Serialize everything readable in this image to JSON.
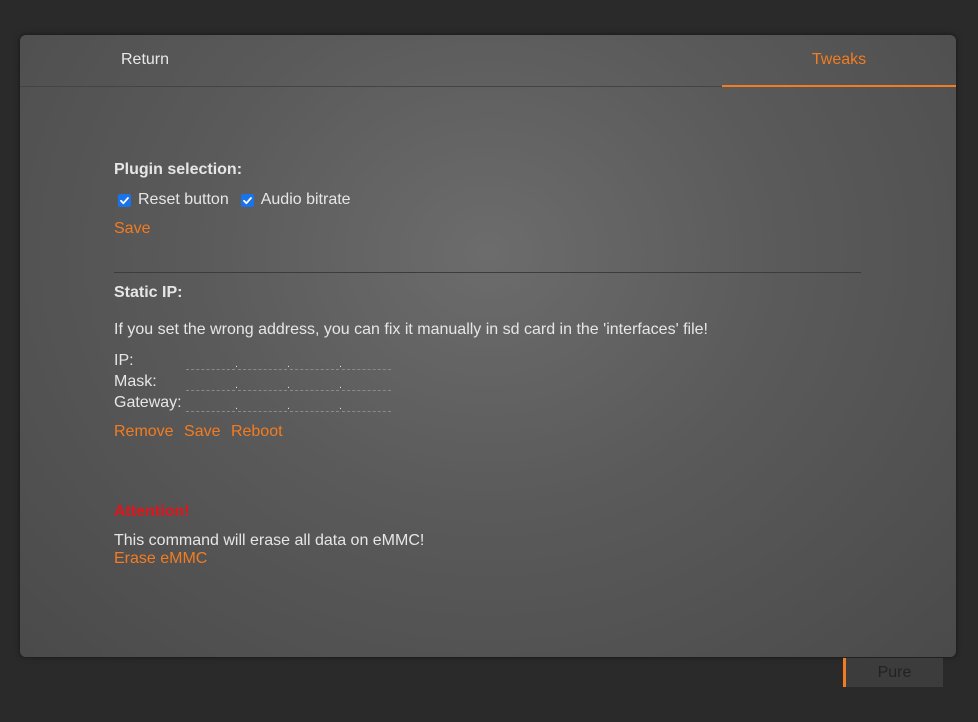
{
  "tabs": {
    "return_label": "Return",
    "tweaks_label": "Tweaks"
  },
  "plugins": {
    "title": "Plugin selection:",
    "items": [
      {
        "label": "Reset button",
        "checked": true
      },
      {
        "label": "Audio bitrate",
        "checked": true
      }
    ],
    "save_label": "Save"
  },
  "static_ip": {
    "title": "Static IP:",
    "warning": "If you set the wrong address, you can fix it manually in sd card in the 'interfaces' file!",
    "fields": [
      {
        "label": "IP:"
      },
      {
        "label": "Mask:"
      },
      {
        "label": "Gateway:"
      }
    ],
    "remove_label": "Remove",
    "save_label": "Save",
    "reboot_label": "Reboot"
  },
  "emmc": {
    "attention": "Attention!",
    "message": "This command will erase all data on eMMC!",
    "erase_label": "Erase eMMC"
  },
  "theme": {
    "pure_label": "Pure",
    "accent_color": "#f47c20",
    "danger_color": "#e0141a"
  }
}
